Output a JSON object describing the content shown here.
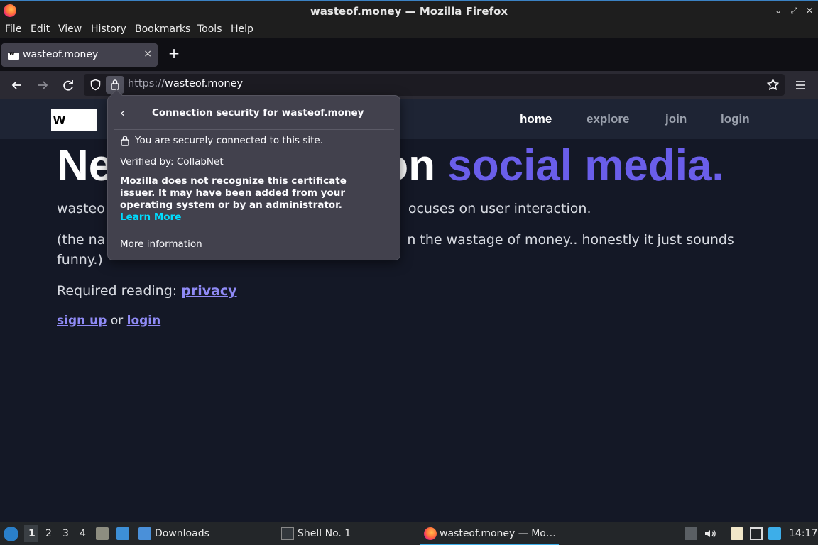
{
  "window": {
    "title": "wasteof.money — Mozilla Firefox"
  },
  "menubar": [
    "File",
    "Edit",
    "View",
    "History",
    "Bookmarks",
    "Tools",
    "Help"
  ],
  "tab": {
    "label": "wasteof.money",
    "close": "×",
    "new_tab": "+"
  },
  "urlbar": {
    "scheme": "https://",
    "host": "wasteof.money"
  },
  "site": {
    "logo": "w",
    "nav": [
      "home",
      "explore",
      "join",
      "login"
    ],
    "hero_start": "Ne",
    "hero_mid": "on",
    "hero_accent": "social media.",
    "desc_start": "wasteo",
    "desc_end": "ocuses on user interaction.",
    "paren_start": "(the na",
    "paren_end": "n the wastage of money.. honestly it just sounds",
    "paren_line2": "funny.)",
    "required_prefix": "Required reading: ",
    "privacy": "privacy",
    "sign_up": "sign up",
    "or": " or ",
    "login": "login"
  },
  "popup": {
    "back": "‹",
    "title": "Connection security for wasteof.money",
    "secure": "You are securely connected to this site.",
    "verified": "Verified by: CollabNet",
    "warning": "Mozilla does not recognize this certificate issuer. It may have been added from your operating system or by an administrator.",
    "learn_more": "Learn More",
    "more_info": "More information"
  },
  "taskbar": {
    "desktops": [
      "1",
      "2",
      "3",
      "4"
    ],
    "downloads": "Downloads",
    "shell": "Shell No. 1",
    "firefox": "wasteof.money — Mo…",
    "clock": "14:17"
  }
}
